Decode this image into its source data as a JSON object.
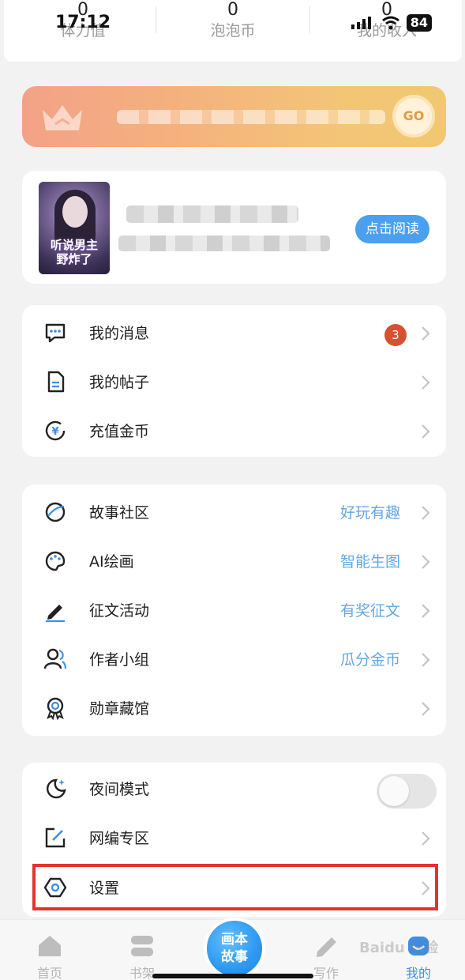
{
  "status_bar": {
    "time": "17:12",
    "battery": "84"
  },
  "stats": [
    {
      "value": "0",
      "label": "体力值"
    },
    {
      "value": "0",
      "label": "泡泡币"
    },
    {
      "value": "0",
      "label": "我的收入"
    }
  ],
  "vip_banner": {
    "go_label": "GO"
  },
  "book_card": {
    "cover_title": "听说男主\n野炸了",
    "read_button": "点击阅读"
  },
  "menu_group_1": [
    {
      "label": "我的消息",
      "badge": "3",
      "icon": "message-icon"
    },
    {
      "label": "我的帖子",
      "icon": "document-icon"
    },
    {
      "label": "充值金币",
      "icon": "coin-icon"
    }
  ],
  "menu_group_2": [
    {
      "label": "故事社区",
      "hint": "好玩有趣",
      "icon": "planet-icon"
    },
    {
      "label": "AI绘画",
      "hint": "智能生图",
      "icon": "palette-icon"
    },
    {
      "label": "征文活动",
      "hint": "有奖征文",
      "icon": "pencil-icon"
    },
    {
      "label": "作者小组",
      "hint": "瓜分金币",
      "icon": "group-icon"
    },
    {
      "label": "勋章藏馆",
      "icon": "medal-icon"
    }
  ],
  "menu_group_3": [
    {
      "label": "夜间模式",
      "icon": "moon-icon",
      "toggle_on": false
    },
    {
      "label": "网编专区",
      "icon": "edit-square-icon"
    },
    {
      "label": "设置",
      "icon": "settings-icon"
    }
  ],
  "tabbar": {
    "tabs": [
      {
        "label": "首页",
        "icon": "home-icon"
      },
      {
        "label": "书架",
        "icon": "bookshelf-icon"
      },
      {
        "label": "写作",
        "icon": "write-icon"
      },
      {
        "label": "我的",
        "icon": "profile-icon",
        "active": true
      }
    ],
    "center_label_1": "画本",
    "center_label_2": "故事"
  },
  "watermark": "Baidu 经验",
  "colors": {
    "accent": "#4aa0ef",
    "hint": "#63a8e6",
    "badge": "#d6512f",
    "highlight": "#e6322e"
  }
}
